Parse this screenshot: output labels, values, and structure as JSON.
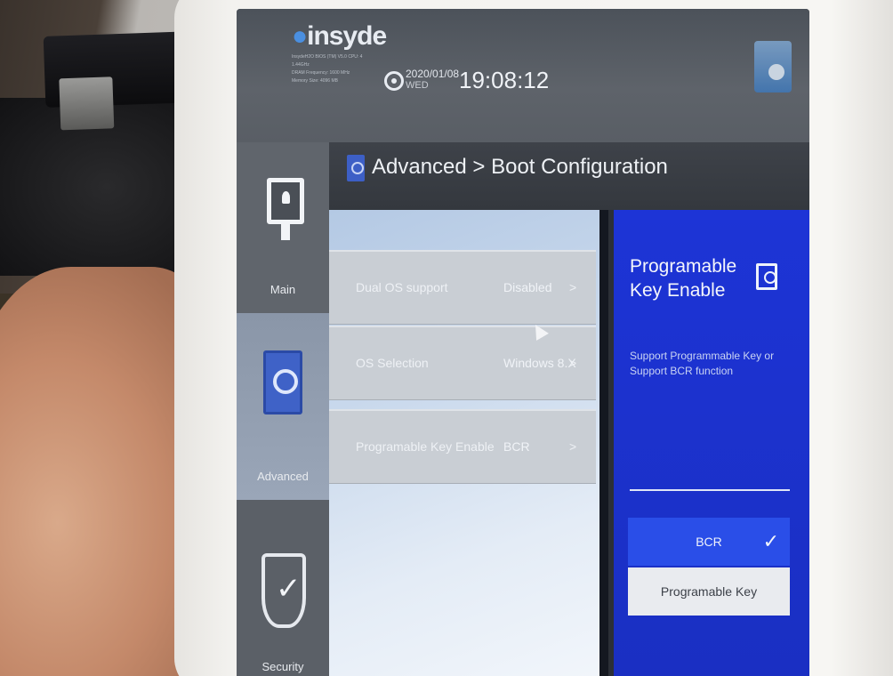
{
  "header": {
    "logo": "insyde",
    "sysinfo": [
      "InsydeH2O BIOS (TM) V5.0 CPU: 4",
      "1.44GHz",
      "DRAM Frequency: 1600 MHz",
      "Memory Size: 4096 MB"
    ],
    "date": "2020/01/08",
    "day_of_week": "WED",
    "time": "19:08:12"
  },
  "breadcrumb": "Advanced > Boot Configuration",
  "sidebar": {
    "items": [
      {
        "label": "Main",
        "icon": "monitor-user-icon"
      },
      {
        "label": "Advanced",
        "icon": "advanced-icon"
      },
      {
        "label": "Security",
        "icon": "shield-check-icon"
      }
    ]
  },
  "settings": [
    {
      "name": "Dual OS support",
      "value": "Disabled",
      "chevron": ">"
    },
    {
      "name": "OS Selection",
      "value": "Windows 8.X",
      "chevron": ">"
    },
    {
      "name": "Programable Key Enable",
      "value": "BCR",
      "chevron": ">"
    }
  ],
  "help": {
    "title": "Programable Key Enable",
    "description": "Support Programmable Key or Support BCR function",
    "options": [
      {
        "label": "BCR",
        "selected": true
      },
      {
        "label": "Programable Key",
        "selected": false
      }
    ]
  },
  "colors": {
    "help_panel": "#1d34d6",
    "selected_option": "#2a4ee8",
    "topbar": "#5e636a"
  }
}
